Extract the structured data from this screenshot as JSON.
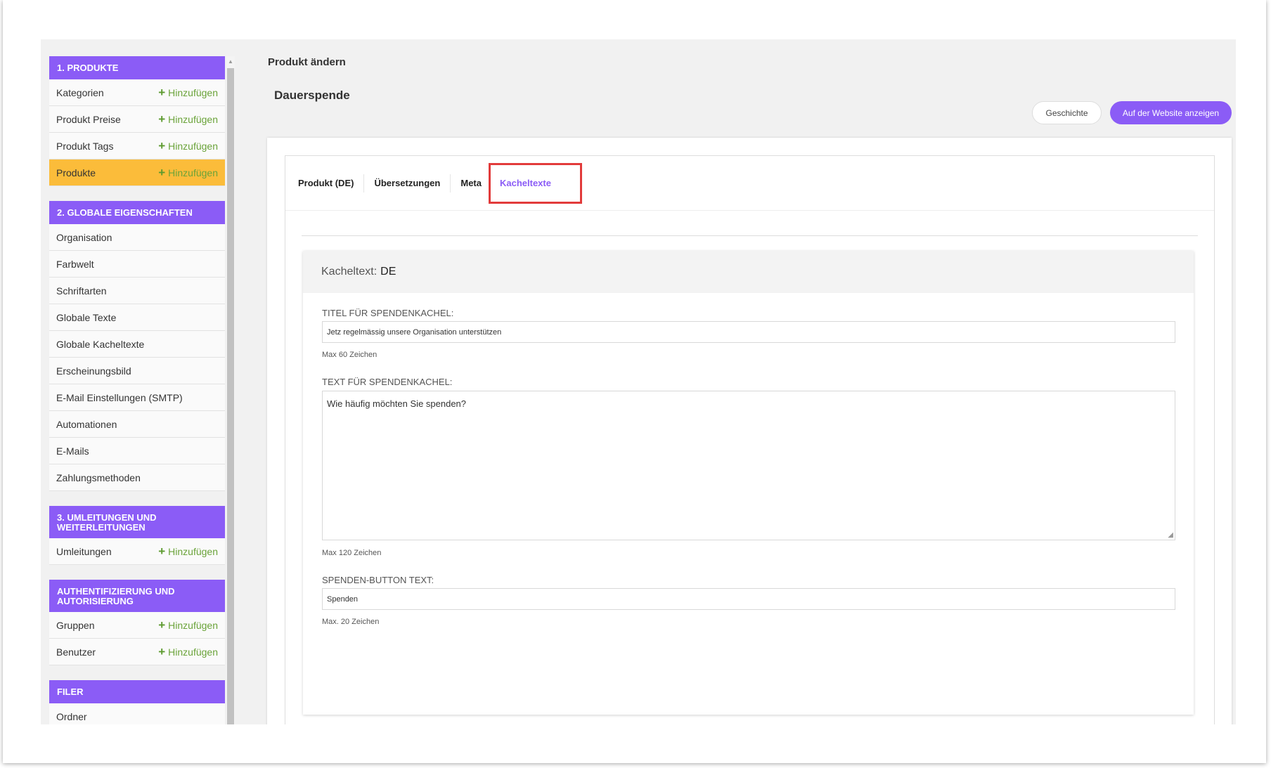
{
  "sidebar": {
    "sections": [
      {
        "title": "1. PRODUKTE",
        "items": [
          {
            "label": "Kategorien",
            "add": "Hinzufügen"
          },
          {
            "label": "Produkt Preise",
            "add": "Hinzufügen"
          },
          {
            "label": "Produkt Tags",
            "add": "Hinzufügen"
          },
          {
            "label": "Produkte",
            "add": "Hinzufügen",
            "active": true
          }
        ]
      },
      {
        "title": "2. GLOBALE EIGENSCHAFTEN",
        "items": [
          {
            "label": "Organisation"
          },
          {
            "label": "Farbwelt"
          },
          {
            "label": "Schriftarten"
          },
          {
            "label": "Globale Texte"
          },
          {
            "label": "Globale Kacheltexte"
          },
          {
            "label": "Erscheinungsbild"
          },
          {
            "label": "E-Mail Einstellungen (SMTP)"
          },
          {
            "label": "Automationen"
          },
          {
            "label": "E-Mails"
          },
          {
            "label": "Zahlungsmethoden"
          }
        ]
      },
      {
        "title": "3. UMLEITUNGEN UND WEITERLEITUNGEN",
        "items": [
          {
            "label": "Umleitungen",
            "add": "Hinzufügen"
          }
        ]
      },
      {
        "title": "AUTHENTIFIZIERUNG UND AUTORISIERUNG",
        "items": [
          {
            "label": "Gruppen",
            "add": "Hinzufügen"
          },
          {
            "label": "Benutzer",
            "add": "Hinzufügen"
          }
        ]
      },
      {
        "title": "FILER",
        "items": [
          {
            "label": "Ordner"
          }
        ]
      }
    ]
  },
  "header": {
    "breadcrumb": "Produkt ändern",
    "title": "Dauerspende",
    "history_button": "Geschichte",
    "website_button": "Auf der Website anzeigen"
  },
  "tabs": [
    {
      "label": "Produkt (DE)"
    },
    {
      "label": "Übersetzungen"
    },
    {
      "label": "Meta"
    },
    {
      "label": "Kacheltexte",
      "active": true
    }
  ],
  "card": {
    "head_label": "Kacheltext:",
    "head_lang": "DE",
    "title_label": "TITEL FÜR SPENDENKACHEL:",
    "title_value": "Jetz regelmässig unsere Organisation unterstützen",
    "title_hint": "Max 60 Zeichen",
    "text_label": "TEXT FÜR SPENDENKACHEL:",
    "text_value": "Wie häufig möchten Sie spenden?",
    "text_hint": "Max 120 Zeichen",
    "button_label": "SPENDEN-BUTTON TEXT:",
    "button_value": "Spenden",
    "button_hint": "Max. 20 Zeichen"
  },
  "colors": {
    "accent": "#8b5cf6",
    "active_item": "#fbbc3a",
    "add_green": "#6aa339",
    "highlight_red": "#e23b3b"
  }
}
